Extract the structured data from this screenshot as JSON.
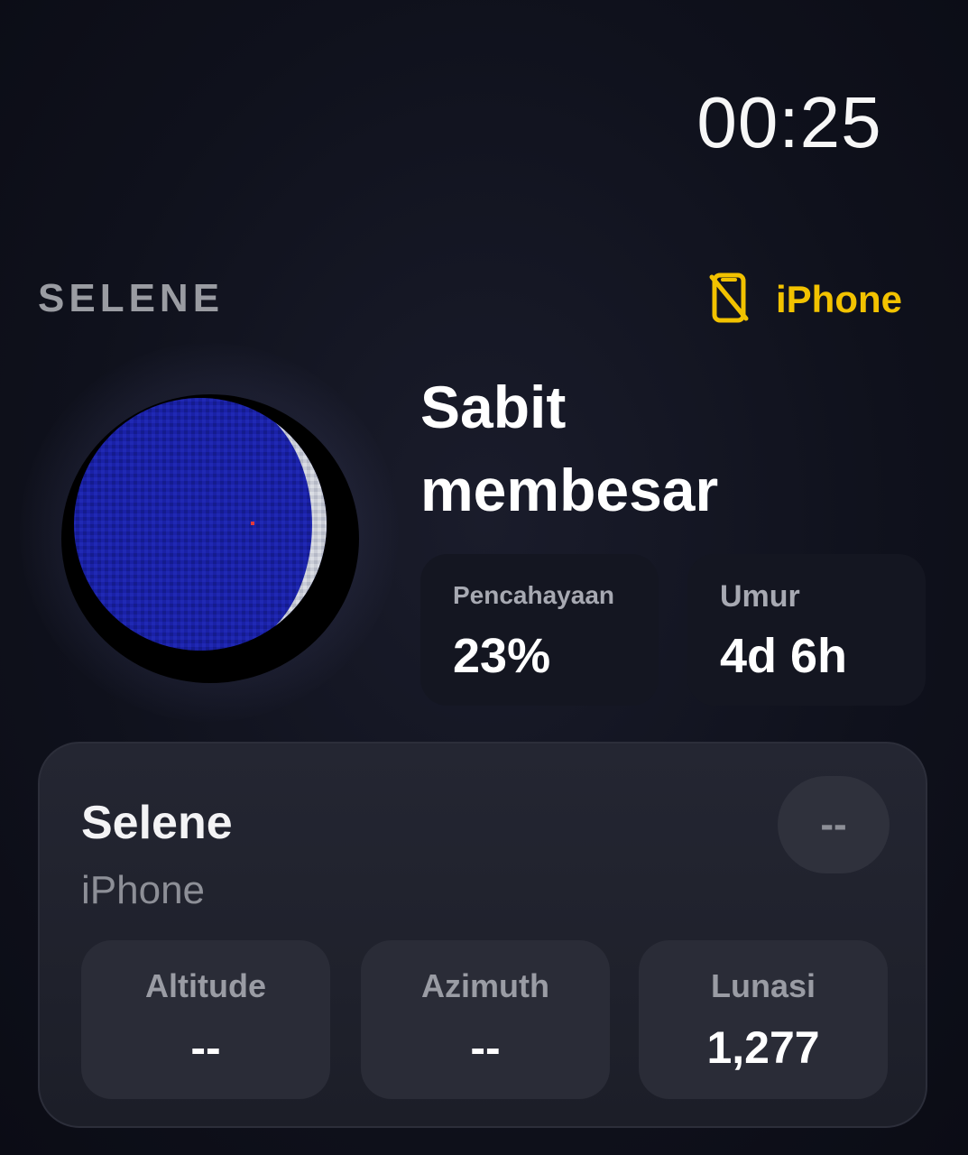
{
  "status": {
    "time": "00:25"
  },
  "header": {
    "brand": "SELENE",
    "device_label": "iPhone",
    "device_icon": "phone-off-icon",
    "accent": "#f2c200"
  },
  "moon": {
    "phase_line1": "Sabit",
    "phase_line2": "membesar",
    "illumination_fraction": 0.23
  },
  "stats": [
    {
      "label": "Pencahayaan",
      "value": "23%"
    },
    {
      "label": "Umur",
      "value": "4d 6h"
    }
  ],
  "card": {
    "title": "Selene",
    "subtitle": "iPhone",
    "pill": "--",
    "metrics": [
      {
        "label": "Altitude",
        "value": "--"
      },
      {
        "label": "Azimuth",
        "value": "--"
      },
      {
        "label": "Lunasi",
        "value": "1,277"
      }
    ]
  },
  "colors": {
    "moon_dark": "#1b22a8",
    "moon_lit": "#c8ccd6"
  }
}
